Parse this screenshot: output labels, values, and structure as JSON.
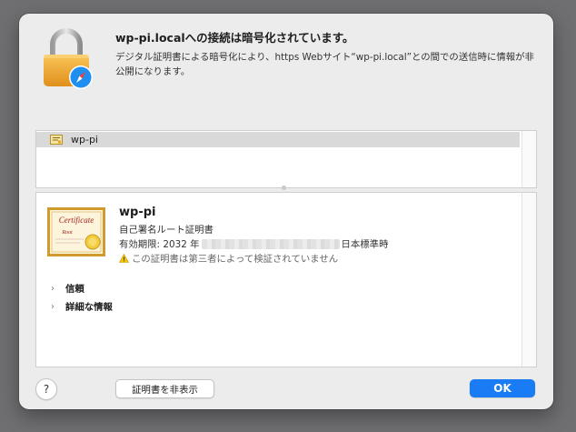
{
  "header": {
    "title": "wp-pi.localへの接続は暗号化されています。",
    "description": "デジタル証明書による暗号化により、https Webサイト“wp-pi.local”との間での送信時に情報が非公開になります。"
  },
  "certificate_list": {
    "items": [
      {
        "label": "wp-pi",
        "selected": true
      }
    ]
  },
  "certificate_detail": {
    "image_text_main": "Certificate",
    "image_text_sub": "Root",
    "name": "wp-pi",
    "type": "自己署名ルート証明書",
    "validity_prefix": "有効期限: 2032 年",
    "validity_suffix": "日本標準時",
    "warning": "この証明書は第三者によって検証されていません",
    "sections": [
      {
        "label": "信頼"
      },
      {
        "label": "詳細な情報"
      }
    ]
  },
  "footer": {
    "help_label": "?",
    "hide_certificate_label": "証明書を非表示",
    "ok_label": "OK"
  },
  "colors": {
    "accent": "#1a7cf5",
    "dialog_bg": "#ececec",
    "selection_bg": "#d9d9d9",
    "lock_gold": "#f0a72a",
    "warning": "#f5c400"
  }
}
